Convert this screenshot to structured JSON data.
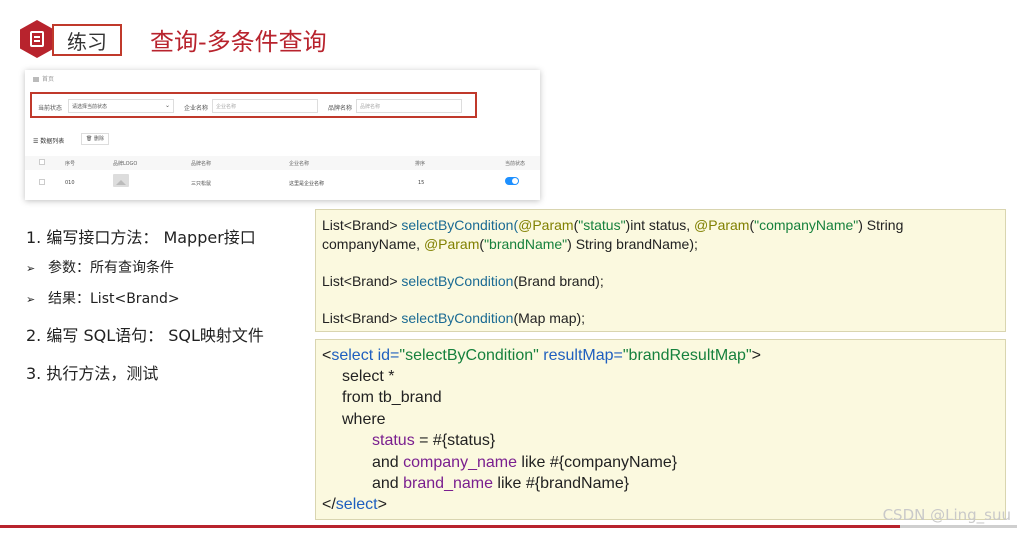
{
  "header": {
    "practice_label": "练习",
    "title": "查询-多条件查询"
  },
  "screenshot": {
    "breadcrumb": "首页",
    "filter": {
      "status_label": "当前状态",
      "status_value": "请选择当前状态",
      "company_label": "企业名称",
      "company_placeholder": "企业名称",
      "brand_label": "品牌名称",
      "brand_placeholder": "品牌名称"
    },
    "list_title": "数据列表",
    "delete_label": "删除",
    "columns": [
      "序号",
      "品牌LOGO",
      "品牌名称",
      "企业名称",
      "排序",
      "当前状态"
    ],
    "row": {
      "id": "010",
      "brand": "三只松鼠",
      "company": "这里是企业名称",
      "order": "15",
      "status_on": true
    }
  },
  "steps": {
    "s1": "1.   编写接口方法： Mapper接口",
    "b1": "参数：所有查询条件",
    "b2": "结果：List<Brand>",
    "s2": "2.   编写 SQL语句： SQL映射文件",
    "s3": "3.   执行方法，测试"
  },
  "code1": {
    "l1_a": "List<Brand> ",
    "l1_b": "selectByCondition(",
    "l1_c": "@Param",
    "l1_d": "(",
    "l1_e": "\"status\"",
    "l1_f": ")int status, ",
    "l1_g": "@Param",
    "l1_h": "(",
    "l1_i": "\"companyName\"",
    "l1_j": ") String",
    "l2_a": "companyName, ",
    "l2_b": "@Param",
    "l2_c": "(",
    "l2_d": "\"brandName\"",
    "l2_e": ") String brandName);",
    "l3_a": "List<Brand> ",
    "l3_b": "selectByCondition",
    "l3_c": "(Brand brand);",
    "l4_a": "List<Brand> ",
    "l4_b": "selectByCondition",
    "l4_c": "(Map map);"
  },
  "code2": {
    "l1_a": "<",
    "l1_b": "select",
    "l1_c": " id=",
    "l1_d": "\"selectByCondition\"",
    "l1_e": " resultMap=",
    "l1_f": "\"brandResultMap\"",
    "l1_g": ">",
    "l2": "select *",
    "l3": "from tb_brand",
    "l4": "where",
    "l5_a": "status",
    "l5_b": " = #{status}",
    "l6_a": "and ",
    "l6_b": "company_name",
    "l6_c": " like #{companyName}",
    "l7_a": "and ",
    "l7_b": "brand_name",
    "l7_c": " like #{brandName}",
    "l8_a": "</",
    "l8_b": "select",
    "l8_c": ">"
  },
  "watermark": "CSDN @Ling_suu"
}
